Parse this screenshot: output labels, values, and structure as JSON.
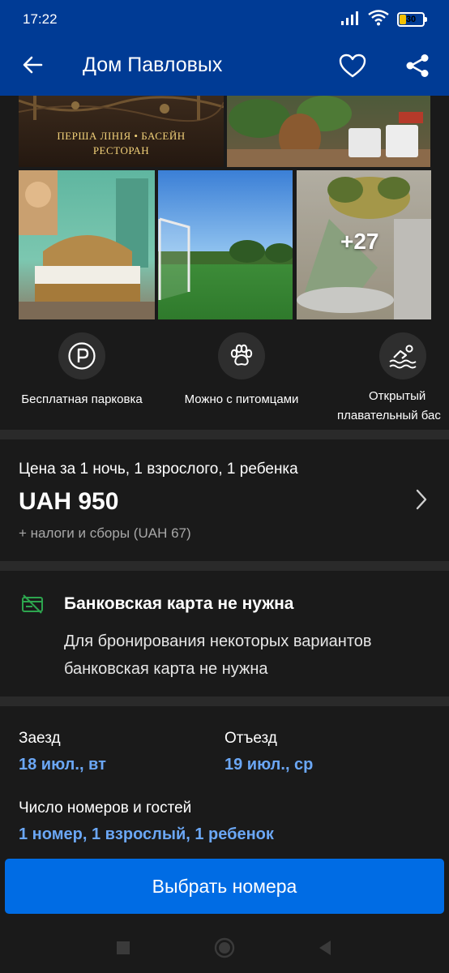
{
  "status_bar": {
    "time": "17:22",
    "battery": "30",
    "battery_level": 0.3,
    "icons": [
      "signal-icon",
      "wifi-icon",
      "battery-icon"
    ]
  },
  "app_bar": {
    "title": "Дом Павловых",
    "icons": [
      "back-arrow-icon",
      "heart-icon",
      "share-icon"
    ]
  },
  "gallery": {
    "banner_caption_line1": "ПЕРША ЛІНІЯ • БАСЕЙН",
    "banner_caption_line2": "РЕСТОРАН",
    "more_photos": "+27"
  },
  "amenities": [
    {
      "icon": "parking-icon",
      "label": "Бесплатная парковка"
    },
    {
      "icon": "paw-icon",
      "label": "Можно с питомцами"
    },
    {
      "icon": "swimming-icon",
      "label_line1": "Открытый",
      "label_line2": "плавательный бас"
    }
  ],
  "price": {
    "caption": "Цена за 1 ночь, 1 взрослого, 1 ребенка",
    "amount": "UAH 950",
    "taxes": "+ налоги и сборы (UAH 67)"
  },
  "card_notice": {
    "icon": "no-credit-card-icon",
    "title": "Банковская карта не нужна",
    "description": "Для бронирования некоторых вариантов банковская карта не нужна"
  },
  "booking": {
    "checkin_label": "Заезд",
    "checkin_value": "18 июл., вт",
    "checkout_label": "Отъезд",
    "checkout_value": "19 июл., ср",
    "guests_label": "Число номеров и гостей",
    "guests_value": "1 номер, 1 взрослый, 1 ребенок"
  },
  "actions": {
    "select_rooms": "Выбрать номера"
  },
  "nav": {
    "icons": [
      "recents-square-icon",
      "home-circle-icon",
      "back-triangle-icon"
    ]
  },
  "colors": {
    "brand_blue": "#003b95",
    "button_blue": "#006ce4",
    "link_blue": "#6ba7f5",
    "background": "#1a1a1a"
  }
}
